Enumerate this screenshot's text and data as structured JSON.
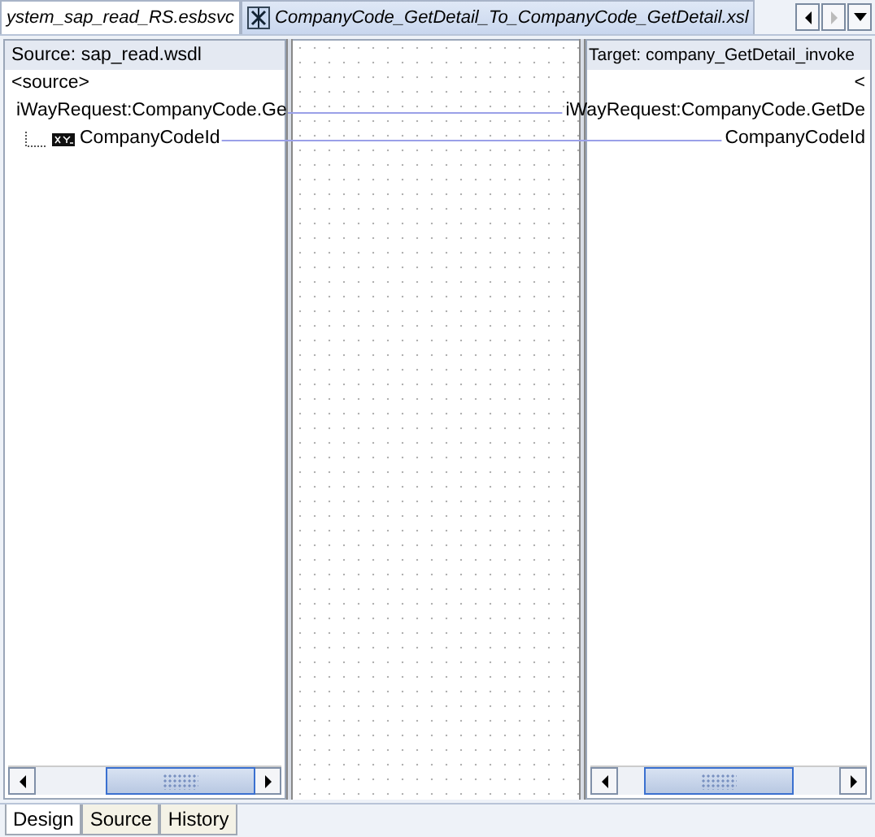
{
  "editor_tabs": [
    {
      "label": "ystem_sap_read_RS.esbsvc",
      "kind": "plain",
      "selected": false
    },
    {
      "label": "CompanyCode_GetDetail_To_CompanyCode_GetDetail.xsl",
      "kind": "xsl",
      "selected": true
    }
  ],
  "source_panel": {
    "title": "Source: sap_read.wsdl",
    "tree": [
      {
        "label": "<source>",
        "kind": "plain"
      },
      {
        "label": "iWayRequest:CompanyCode.Ge",
        "kind": "element",
        "children": [
          {
            "label": "CompanyCodeId",
            "kind": "field"
          }
        ]
      }
    ]
  },
  "target_panel": {
    "title": "Target: company_GetDetail_invoke",
    "items": [
      {
        "label": "<"
      },
      {
        "label": "iWayRequest:CompanyCode.GetDe"
      },
      {
        "label": "CompanyCodeId"
      }
    ]
  },
  "bottom_tabs": [
    {
      "label": "Design",
      "selected": true
    },
    {
      "label": "Source",
      "selected": false
    },
    {
      "label": "History",
      "selected": false
    }
  ]
}
